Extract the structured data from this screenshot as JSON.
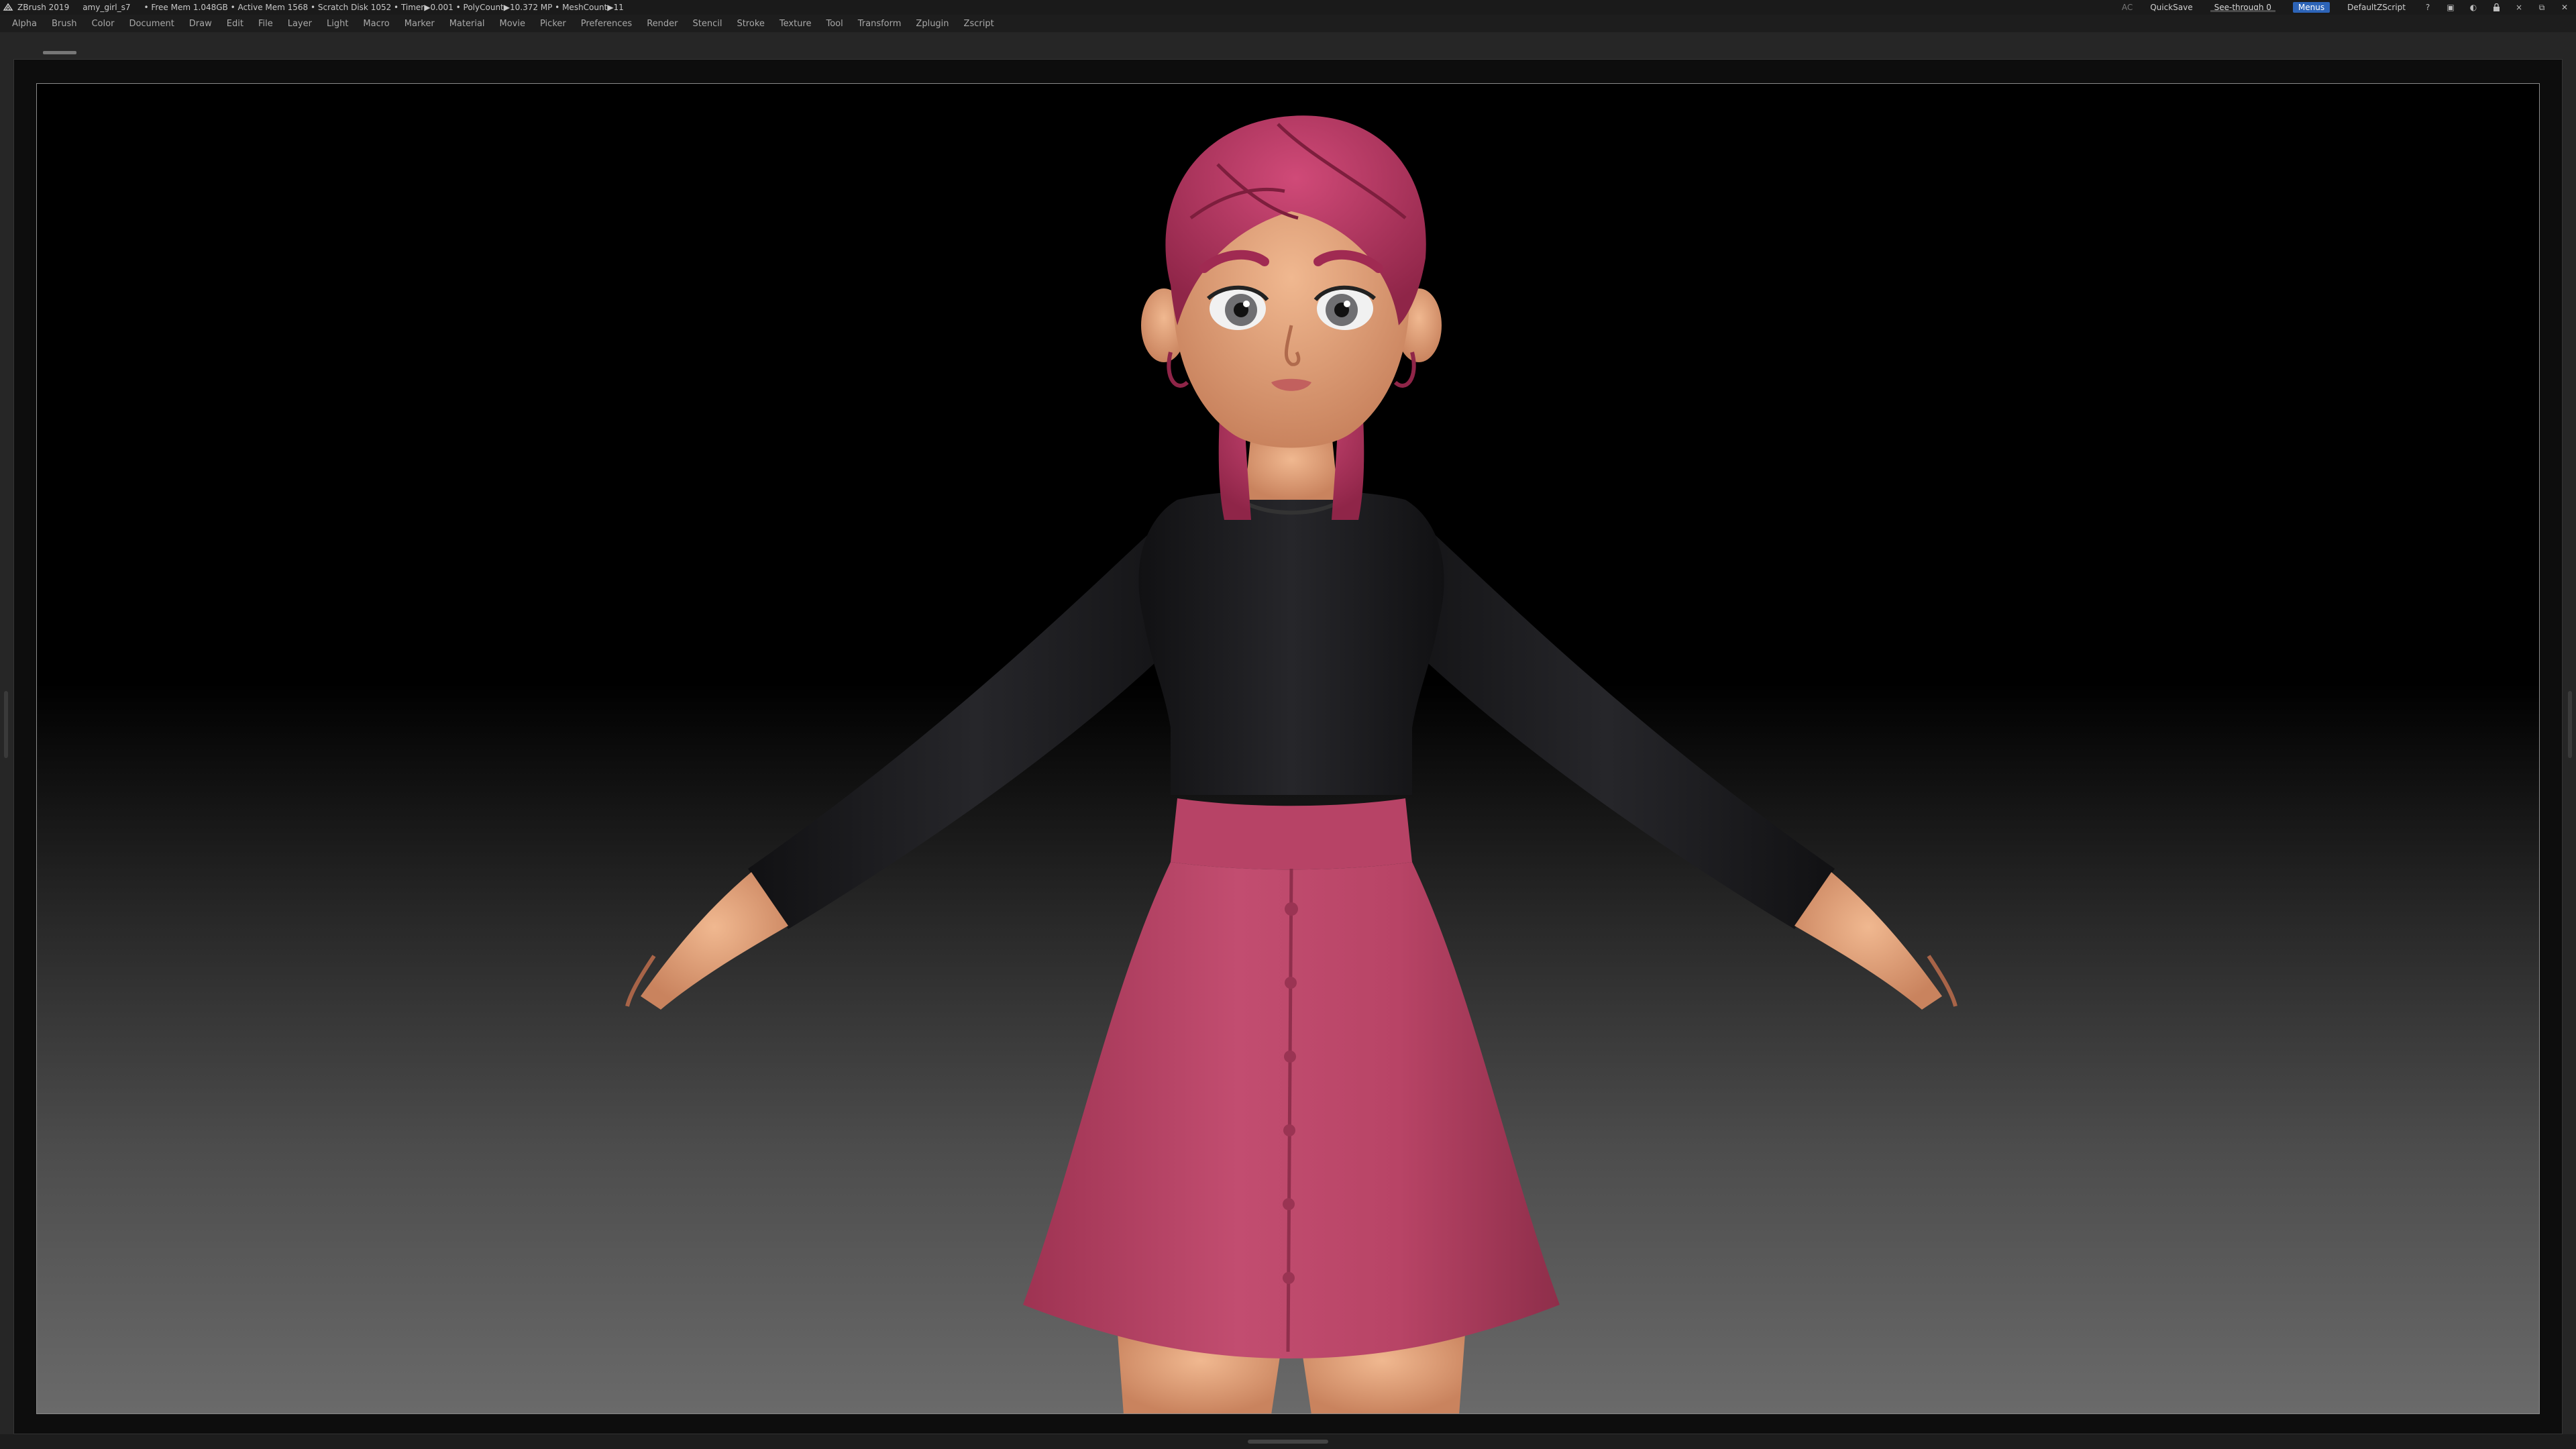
{
  "titlebar": {
    "app_name": "ZBrush 2019",
    "file_name": "amy_girl_s7",
    "stats": "• Free Mem 1.048GB • Active Mem 1568 • Scratch Disk 1052 • Timer▶0.001 • PolyCount▶10.372 MP • MeshCount▶11",
    "ac_label": "AC",
    "quicksave_label": "QuickSave",
    "see_through_label": "See-through  0",
    "see_through_value": 0,
    "menus_label": "Menus",
    "zscript_label": "DefaultZScript"
  },
  "menubar": {
    "items": [
      "Alpha",
      "Brush",
      "Color",
      "Document",
      "Draw",
      "Edit",
      "File",
      "Layer",
      "Light",
      "Macro",
      "Marker",
      "Material",
      "Movie",
      "Picker",
      "Preferences",
      "Render",
      "Stencil",
      "Stroke",
      "Texture",
      "Tool",
      "Transform",
      "Zplugin",
      "Zscript"
    ]
  },
  "icons": {
    "app_logo": "zbrush-logo-icon",
    "window_controls": [
      "help-icon",
      "layout-icon",
      "palette-icon",
      "lock-icon",
      "minimize-icon",
      "restore-icon",
      "close-icon"
    ]
  },
  "colors": {
    "accent_blue": "#2d64b8",
    "slider_orange": "#d7a93a",
    "hair": "#b93a64",
    "skirt": "#b84466",
    "top": "#1c1c1e",
    "skin": "#e8ad86"
  }
}
